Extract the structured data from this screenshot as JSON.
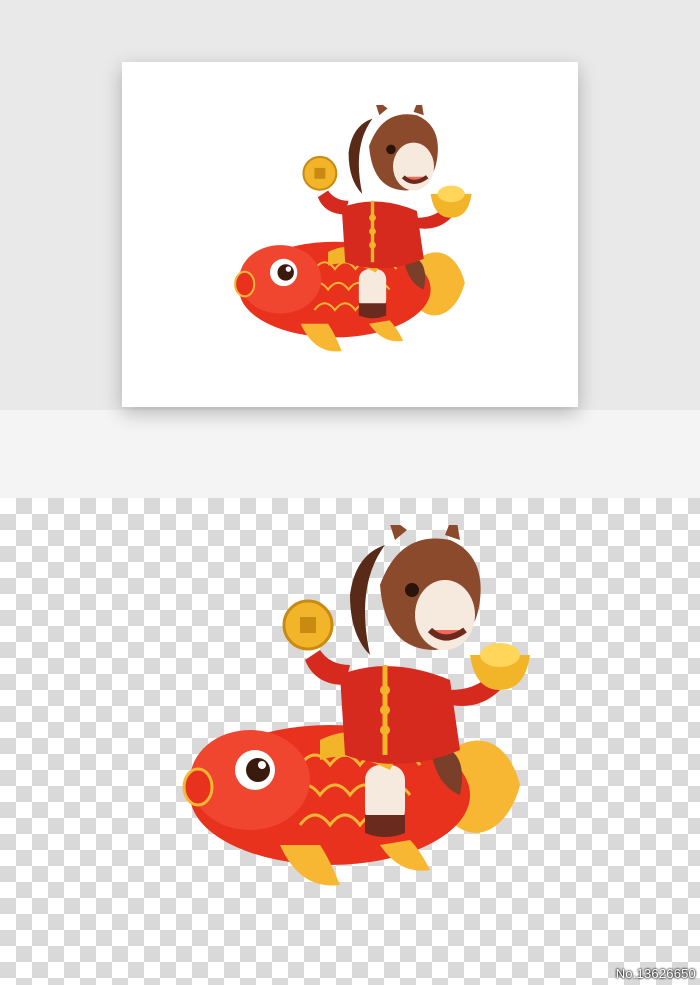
{
  "watermark": {
    "id_text": "No.13626650"
  },
  "illustration": {
    "icon": "horse-riding-koi-fish",
    "colors": {
      "fish_red": "#e8321e",
      "fish_gold": "#f7b733",
      "coat_red": "#d62a1e",
      "horse_brown": "#8b4a2b",
      "gold": "#f2b52a"
    }
  }
}
